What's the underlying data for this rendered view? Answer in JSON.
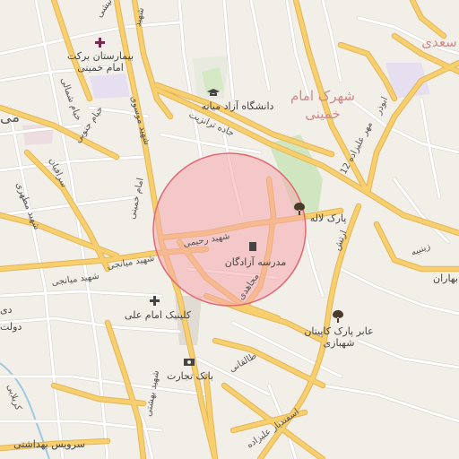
{
  "map": {
    "colors": {
      "background": "#f2efe9",
      "major_road": "#f7cf6e",
      "major_road_casing": "#e4b656",
      "minor_road": "#ffffff",
      "minor_road_casing": "#d8d3cb",
      "park": "#cfe6c0",
      "circle_fill": "#f5a8ad",
      "circle_stroke": "#e06a72",
      "river": "#9ecae1",
      "landuse_pink": "#eedde0",
      "landuse_purple": "#e6dff0"
    },
    "labels": {
      "hospital_line1": "بیمارستان برکت",
      "hospital_line2": "امام خمینی",
      "university": "دانشگاه آزاد میانه",
      "district_line1": "شهرک امام",
      "district_line2": "خمینی",
      "district_top": "سعدی",
      "park_laleh": "پارک لاله",
      "school": "مدرسه آزادگان",
      "clinic": "کلینیک امام علی",
      "bank": "بانک تجارت",
      "service": "سرویس بهداشتی",
      "kapitan_line1": "عابر پارک کاپیتان",
      "kapitan_line2": "شهبازی",
      "baharan": "بهاران",
      "road_azadi": "جاده ترانزیت",
      "road_12mehr": "12 مهر علیزاده",
      "road_rahimi": "شهید رحیمی",
      "road_mianeji": "شهید میانجی",
      "road_mojahedi": "مجاهدی",
      "road_imam_khomeini": "امام خمینی",
      "road_shahid_beheshti": "شهید بهشتی",
      "road_taleghani": "طالقانی",
      "road_esfandiar": "اسفندیار علیزاده",
      "road_abuzar": "ابوذر",
      "road_artesh": "ارتش",
      "road_zeinabiyeh": "زینبیه",
      "road_motahari": "شهید مطهری",
      "road_khayyam": "خیام شمالی",
      "road_khayyam_south": "خیام جنوبی",
      "road_sarafiyan": "سرافیان",
      "road_mousavi": "شهید موسوی",
      "road_karbalaei": "کربلایی",
      "road_top_a": "نیشی",
      "road_top_b": "شهید",
      "edge_mi": "می",
      "edge_dolat": "دولت",
      "edge_di": "دی"
    }
  }
}
